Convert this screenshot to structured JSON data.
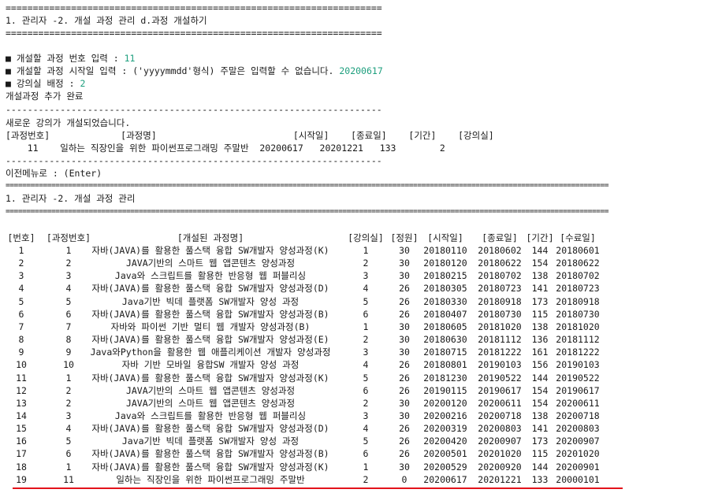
{
  "screen1": {
    "sep_top": "=====================================================================",
    "title": "1. 관리자 -2. 개설 과정 관리 d.과정 개설하기",
    "sep_bottom": "=====================================================================",
    "prompts": [
      {
        "label": "■ 개설할 과정 번호 입력 : ",
        "value": "11"
      },
      {
        "label": "■ 개설할 과정 시작일 입력 : ('yyyymmdd'형식) 주말은 입력할 수 없습니다. ",
        "value": "20200617"
      },
      {
        "label": "■ 강의실 배정 : ",
        "value": "2"
      }
    ],
    "added_msg": "개설과정 추가 완료",
    "dash1": "---------------------------------------------------------------------",
    "new_msg": "새로운 강의가 개설되었습니다.",
    "new_header": "[과정번호]             [과정명]                         [시작일]    [종료일]    [기간]    [강의실]",
    "new_row": "    11    일하는 직장인을 위한 파이썬프로그래밍 주말반  20200617   20201221   133        2",
    "dash2": "---------------------------------------------------------------------",
    "back_msg": "이전메뉴로 : (Enter)"
  },
  "screen2": {
    "sep_top": "=================================================================================================================================================",
    "title": "1. 관리자 -2. 개설 과정 관리",
    "sep_bottom": "=================================================================================================================================================",
    "columns": [
      "[번호]",
      "[과정번호]",
      "[개설된 과정명]",
      "[강의실]",
      "[정원]",
      "[시작일]",
      "[종료일]",
      "[기간]",
      "[수료일]"
    ],
    "rows": [
      [
        "1",
        "1",
        "자바(JAVA)를 활용한 풀스택 융합 SW개발자 양성과정(K)",
        "1",
        "30",
        "20180110",
        "20180602",
        "144",
        "20180601"
      ],
      [
        "2",
        "2",
        "JAVA기반의 스마트 웹 앱콘텐츠 양성과정",
        "2",
        "30",
        "20180120",
        "20180622",
        "154",
        "20180622"
      ],
      [
        "3",
        "3",
        "Java와 스크립트를 활용한 반응형 웹 퍼블리싱",
        "3",
        "30",
        "20180215",
        "20180702",
        "138",
        "20180702"
      ],
      [
        "4",
        "4",
        "자바(JAVA)를 활용한 풀스택 융합 SW개발자 양성과정(D)",
        "4",
        "26",
        "20180305",
        "20180723",
        "141",
        "20180723"
      ],
      [
        "5",
        "5",
        "Java기반 빅데 플랫폼 SW개발자 양성 과정",
        "5",
        "26",
        "20180330",
        "20180918",
        "173",
        "20180918"
      ],
      [
        "6",
        "6",
        "자바(JAVA)를 활용한 풀스택 융합 SW개발자 양성과정(B)",
        "6",
        "26",
        "20180407",
        "20180730",
        "115",
        "20180730"
      ],
      [
        "7",
        "7",
        "자바와 파이썬 기반 멀티 웹 개발자 양성과정(B)",
        "1",
        "30",
        "20180605",
        "20181020",
        "138",
        "20181020"
      ],
      [
        "8",
        "8",
        "자바(JAVA)를 활용한 풀스택 융합 SW개발자 양성과정(E)",
        "2",
        "30",
        "20180630",
        "20181112",
        "136",
        "20181112"
      ],
      [
        "9",
        "9",
        "Java와Python을 활용한 웹 애플리케이션 개발자 양성과정",
        "3",
        "30",
        "20180715",
        "20181222",
        "161",
        "20181222"
      ],
      [
        "10",
        "10",
        "자바 기반 모바일 융합SW 개발자 양성 과정",
        "4",
        "26",
        "20180801",
        "20190103",
        "156",
        "20190103"
      ],
      [
        "11",
        "1",
        "자바(JAVA)를 활용한 풀스택 융합 SW개발자 양성과정(K)",
        "5",
        "26",
        "20181230",
        "20190522",
        "144",
        "20190522"
      ],
      [
        "12",
        "2",
        "JAVA기반의 스마트 웹 앱콘텐츠 양성과정",
        "6",
        "26",
        "20190115",
        "20190617",
        "154",
        "20190617"
      ],
      [
        "13",
        "2",
        "JAVA기반의 스마트 웹 앱콘텐츠 양성과정",
        "2",
        "30",
        "20200120",
        "20200611",
        "154",
        "20200611"
      ],
      [
        "14",
        "3",
        "Java와 스크립트를 활용한 반응형 웹 퍼블리싱",
        "3",
        "30",
        "20200216",
        "20200718",
        "138",
        "20200718"
      ],
      [
        "15",
        "4",
        "자바(JAVA)를 활용한 풀스택 융합 SW개발자 양성과정(D)",
        "4",
        "26",
        "20200319",
        "20200803",
        "141",
        "20200803"
      ],
      [
        "16",
        "5",
        "Java기반 빅데 플랫폼 SW개발자 양성 과정",
        "5",
        "26",
        "20200420",
        "20200907",
        "173",
        "20200907"
      ],
      [
        "17",
        "6",
        "자바(JAVA)를 활용한 풀스택 융합 SW개발자 양성과정(B)",
        "6",
        "26",
        "20200501",
        "20201020",
        "115",
        "20201020"
      ],
      [
        "18",
        "1",
        "자바(JAVA)를 활용한 풀스택 융합 SW개발자 양성과정(K)",
        "1",
        "30",
        "20200529",
        "20200920",
        "144",
        "20200901"
      ],
      [
        "19",
        "11",
        "일하는 직장인을 위한 파이썬프로그래밍 주말반",
        "2",
        "0",
        "20200617",
        "20201221",
        "133",
        "20000101"
      ]
    ]
  },
  "colors": {
    "input_value": "#1e9f7e",
    "highlight_underline": "#e3131b"
  }
}
